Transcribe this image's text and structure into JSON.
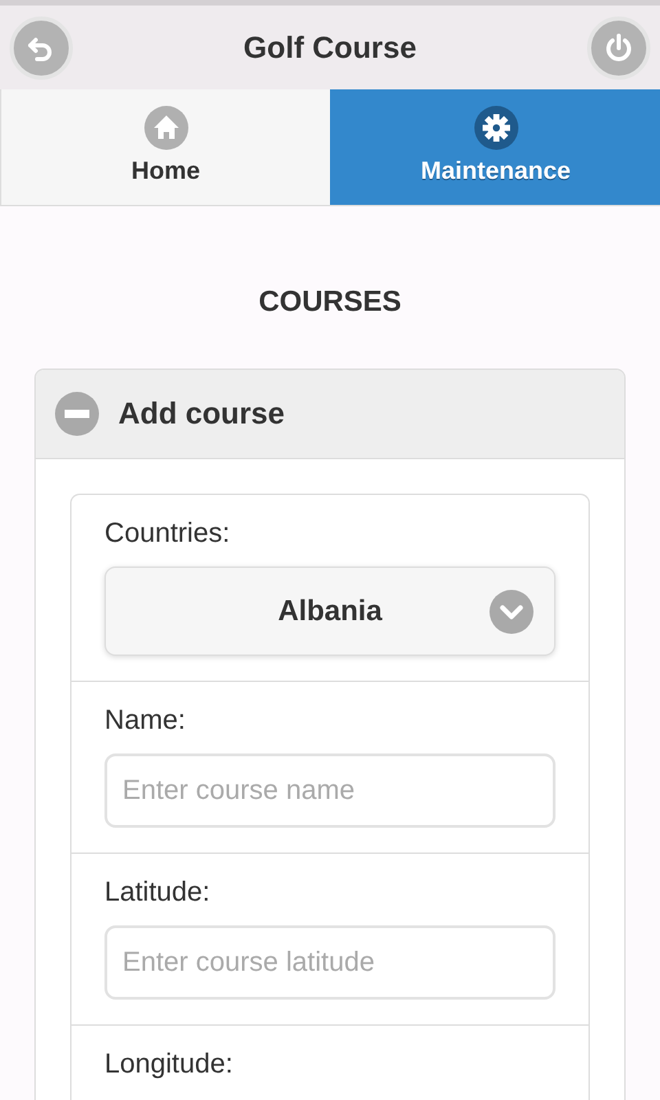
{
  "header": {
    "title": "Golf Course"
  },
  "tabs": [
    {
      "label": "Home",
      "selected": false
    },
    {
      "label": "Maintenance",
      "selected": true
    }
  ],
  "heading": "COURSES",
  "collapsible": {
    "title": "Add course",
    "expanded": true,
    "fields": [
      {
        "kind": "select",
        "label": "Countries:",
        "value": "Albania"
      },
      {
        "kind": "text",
        "label": "Name:",
        "placeholder": "Enter course name"
      },
      {
        "kind": "text",
        "label": "Latitude:",
        "placeholder": "Enter course latitude"
      },
      {
        "kind": "text",
        "label": "Longitude:"
      }
    ]
  }
}
